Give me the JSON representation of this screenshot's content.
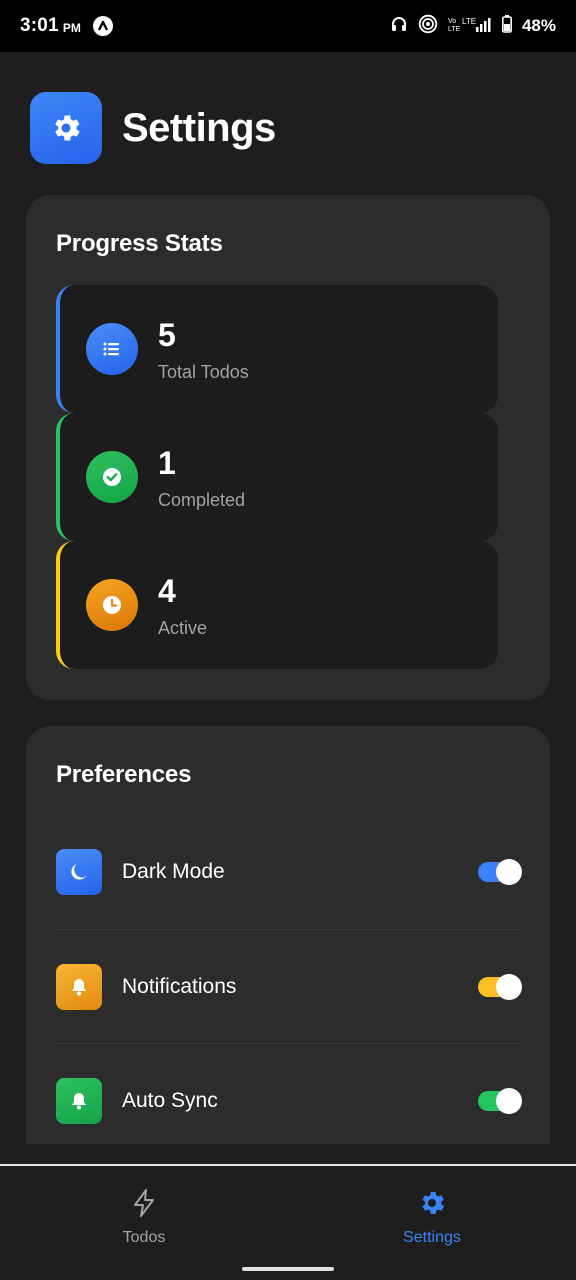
{
  "status_bar": {
    "time": "3:01",
    "ampm": "PM",
    "battery": "48%",
    "icons": [
      "app-icon",
      "headphones-icon",
      "hotspot-icon",
      "signal-icon",
      "battery-icon"
    ]
  },
  "header": {
    "title": "Settings",
    "icon": "gear-icon"
  },
  "stats": {
    "title": "Progress Stats",
    "items": [
      {
        "value": "5",
        "label": "Total Todos",
        "icon": "list-icon",
        "color": "#3b82f6"
      },
      {
        "value": "1",
        "label": "Completed",
        "icon": "check-circle-icon",
        "color": "#22c55e"
      },
      {
        "value": "4",
        "label": "Active",
        "icon": "clock-icon",
        "color": "#facc15"
      }
    ]
  },
  "preferences": {
    "title": "Preferences",
    "items": [
      {
        "label": "Dark Mode",
        "icon": "moon-icon",
        "color": "#3b82f6",
        "enabled": true
      },
      {
        "label": "Notifications",
        "icon": "bell-icon",
        "color": "#f59e0b",
        "enabled": true
      },
      {
        "label": "Auto Sync",
        "icon": "bell-icon",
        "color": "#22c55e",
        "enabled": true
      }
    ]
  },
  "bottom_nav": {
    "items": [
      {
        "label": "Todos",
        "icon": "lightning-icon",
        "active": false
      },
      {
        "label": "Settings",
        "icon": "gear-icon",
        "active": true
      }
    ],
    "active_color": "#3b82f6",
    "inactive_color": "#a3a3a3"
  }
}
